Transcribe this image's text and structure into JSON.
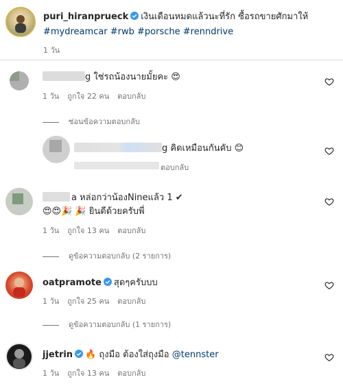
{
  "post": {
    "username": "puri_hiranprueck",
    "caption": "เงินเดือนหมดแล้วนะที่รัก ซื้อรถขายศักมาให้",
    "hashtags": "#mydreamcar #rwb #porsche #renndrive",
    "time": "1 วัน"
  },
  "comments": [
    {
      "username_suffix": "g",
      "text": "ใช่รถน้องนายมั้ยคะ 😍",
      "time": "1 วัน",
      "likes": "ถูกใจ 22 คน",
      "reply": "ตอบกลับ",
      "thread_label": "ซ่อนข้อความตอบกลับ"
    },
    {
      "username_suffix": "g",
      "text": "คิดเหมือนกันคับ 😊",
      "reply": "ตอบกลับ"
    },
    {
      "username_suffix": "a",
      "text": "หล่อกว่าน้องNineแล้ว 1 ✔",
      "text2": "😍😍🎉 🎉 ยินดีด้วยครับพี่",
      "time": "1 วัน",
      "likes": "ถูกใจ 13 คน",
      "reply": "ตอบกลับ",
      "thread_label": "ดูข้อความตอบกลับ (2 รายการ)"
    },
    {
      "username": "oatpramote",
      "text": "สุดๆครับบบ",
      "time": "1 วัน",
      "likes": "ถูกใจ 25 คน",
      "reply": "ตอบกลับ",
      "thread_label": "ดูข้อความตอบกลับ (1 รายการ)"
    },
    {
      "username": "jjetrin",
      "text": "🔥 ถุงมือ ต้องใส่ถุงมือ",
      "mention": "@tennster",
      "time": "1 วัน",
      "likes": "ถูกใจ 13 คน",
      "reply": "ตอบกลับ"
    }
  ],
  "colors": {
    "verified": "#3897f0",
    "link": "#00376b",
    "meta": "#737373"
  }
}
